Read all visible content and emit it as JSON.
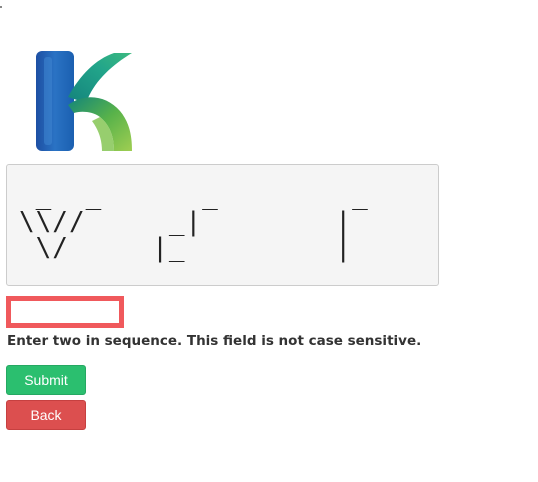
{
  "logo": {
    "icon": "k-logo-icon"
  },
  "captcha": {
    "ascii_art": " _  _      _        _        _\n\\\\//     _|        |       _|\n \\/     |_         |      |_"
  },
  "answer_input": {
    "value": "",
    "placeholder": ""
  },
  "instruction": "Enter two in sequence. This field is not case sensitive.",
  "buttons": {
    "submit_label": "Submit",
    "back_label": "Back"
  },
  "colors": {
    "submit": "#2bbf6f",
    "back": "#dc4f4f",
    "input_highlight": "#f0595c"
  }
}
